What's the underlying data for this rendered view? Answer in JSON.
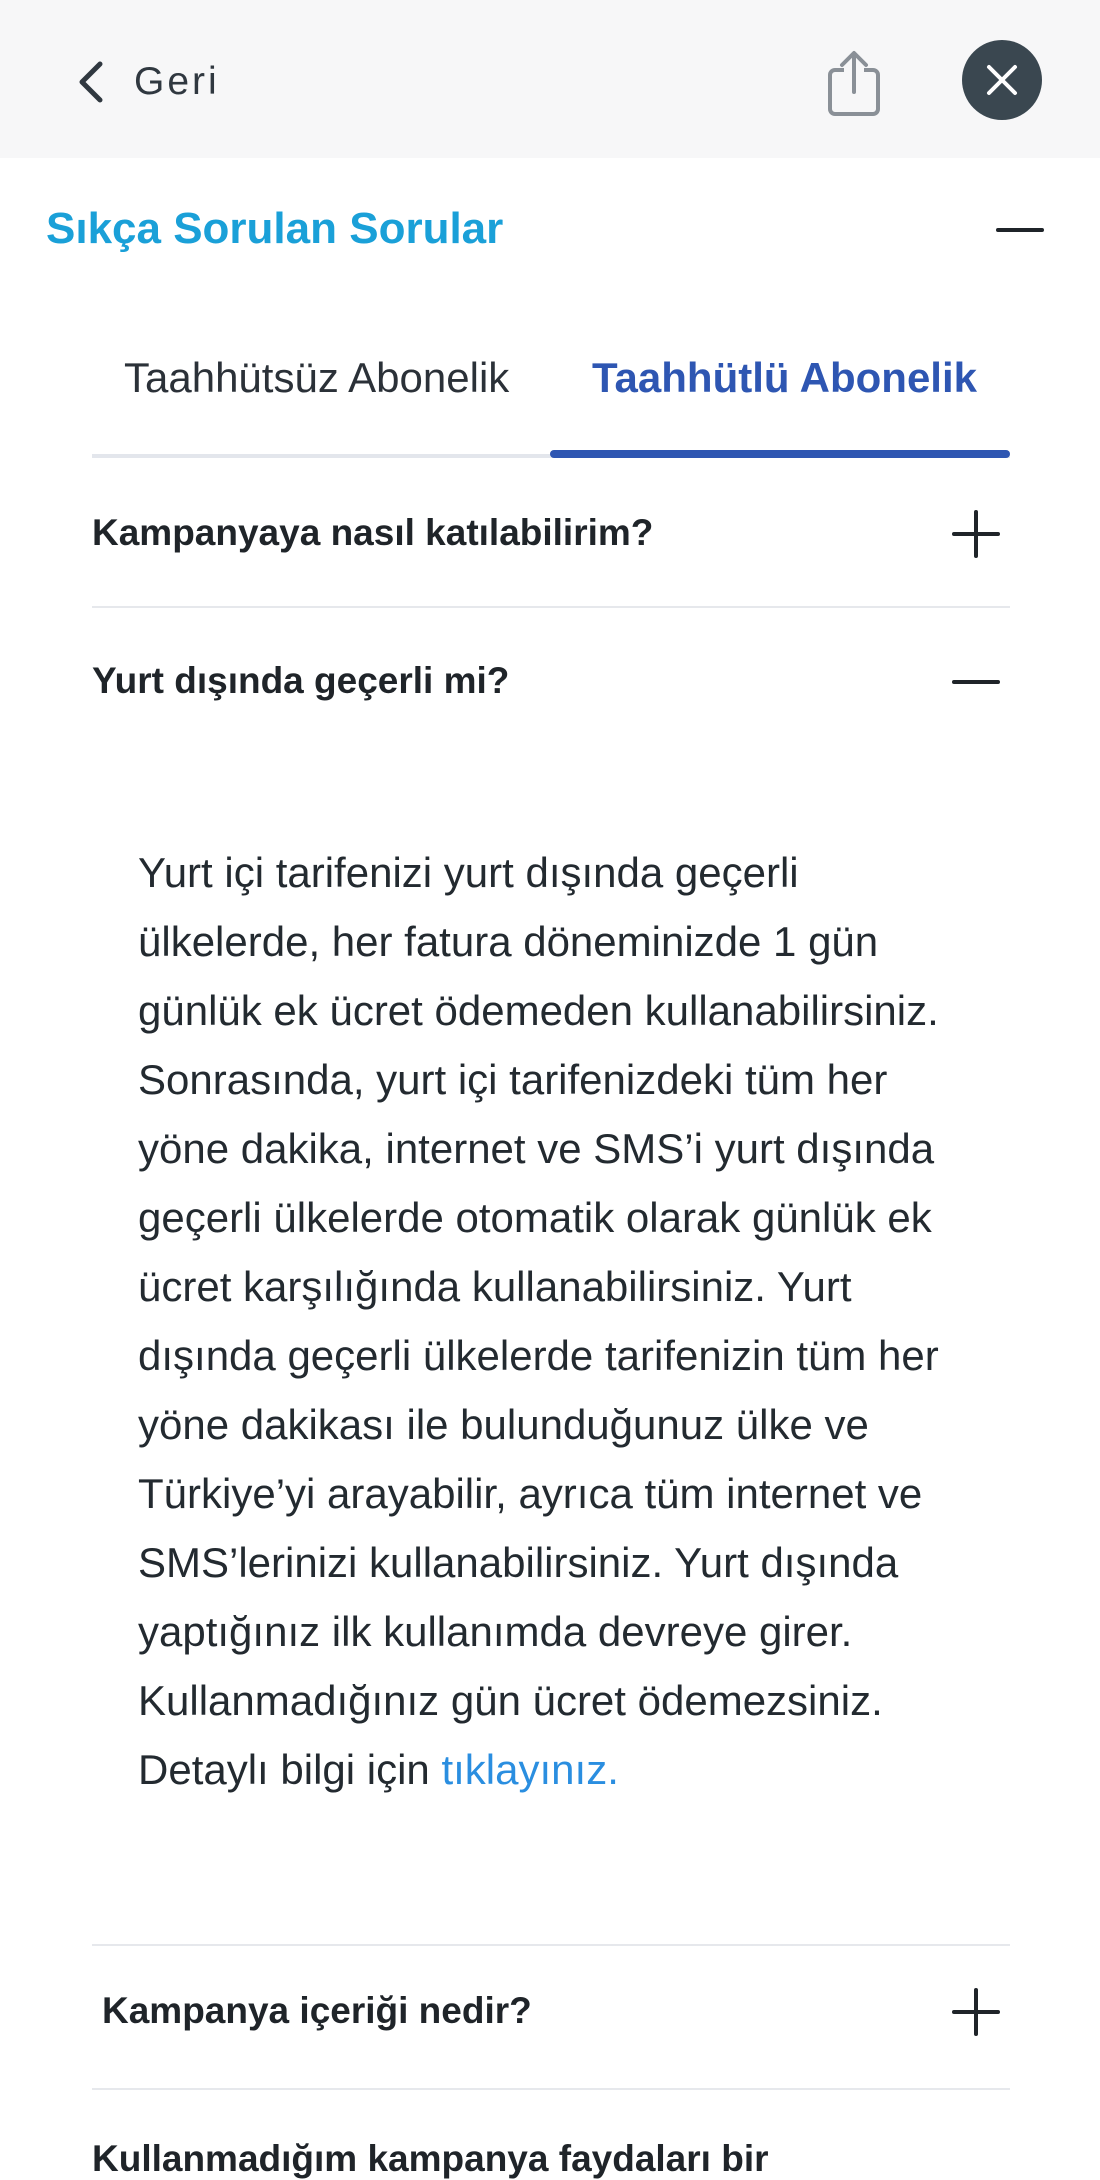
{
  "header": {
    "back_label": "Geri",
    "icons": {
      "back": "chevron-left-icon",
      "share": "share-icon",
      "close": "close-icon"
    }
  },
  "section": {
    "title": "Sıkça Sorulan Sorular",
    "toggle_icon": "minus-icon"
  },
  "tabs": [
    {
      "label": "Taahhütsüz Abonelik",
      "active": false
    },
    {
      "label": "Taahhütlü Abonelik",
      "active": true
    }
  ],
  "faq": [
    {
      "question": "Kampanyaya nasıl katılabilirim?",
      "expanded": false
    },
    {
      "question": "Yurt dışında geçerli mi?",
      "expanded": true,
      "answer": "Yurt içi tarifenizi yurt dışında geçerli ülkelerde, her fatura döneminizde 1 gün günlük ek ücret ödemeden kullanabilirsiniz. Sonrasında, yurt içi tarifenizdeki tüm her yöne dakika, internet ve SMS’i yurt dışında geçerli ülkelerde otomatik olarak günlük ek ücret karşılığında kullanabilirsiniz. Yurt dışında geçerli ülkelerde tarifenizin tüm her yöne dakikası ile bulunduğunuz ülke ve Türkiye’yi arayabilir, ayrıca tüm internet ve SMS’lerinizi kullanabilirsiniz. Yurt dışında yaptığınız ilk kullanımda devreye girer. Kullanmadığınız gün ücret ödemezsiniz. Detaylı bilgi için",
      "answer_link": "tıklayınız."
    },
    {
      "question": "Kampanya içeriği nedir?",
      "expanded": false
    },
    {
      "question": "Kullanmadığım kampanya faydaları bir",
      "expanded": false
    }
  ],
  "colors": {
    "accent": "#1aa0d8",
    "active_tab": "#2e56b2",
    "link": "#2a8ee0",
    "close_bg": "#3a4750"
  }
}
